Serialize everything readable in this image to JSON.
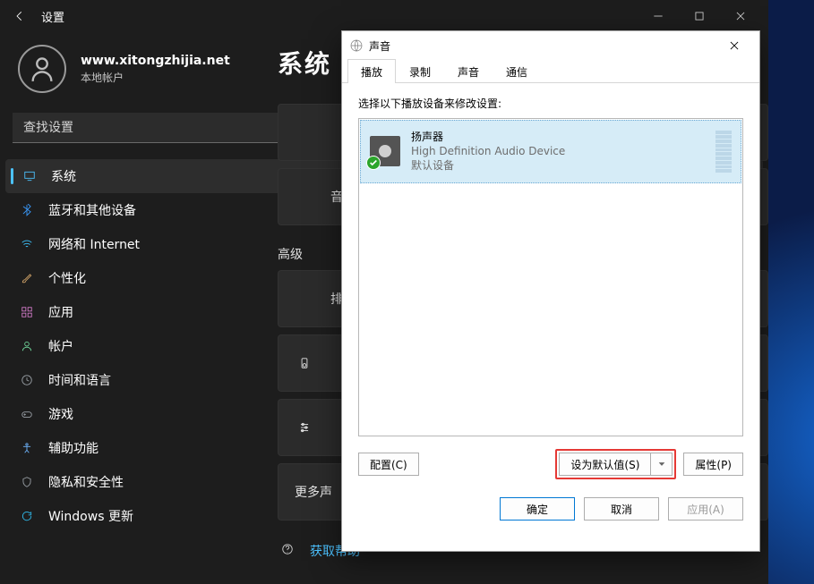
{
  "settings": {
    "title": "设置",
    "user": {
      "name": "www.xitongzhijia.net",
      "sub": "本地帐户"
    },
    "search_placeholder": "查找设置",
    "nav": {
      "system": "系统",
      "bluetooth": "蓝牙和其他设备",
      "network": "网络和 Internet",
      "personal": "个性化",
      "apps": "应用",
      "accounts": "帐户",
      "time": "时间和语言",
      "game": "游戏",
      "access": "辅助功能",
      "privacy": "隐私和安全性",
      "update": "Windows 更新"
    },
    "main": {
      "page_title": "系统",
      "card_sound": "音量",
      "section_advanced": "高级",
      "card_trouble": "排查常",
      "card_more": "更多声",
      "help_link": "获取帮助"
    }
  },
  "sound_dialog": {
    "title": "声音",
    "tabs": {
      "play": "播放",
      "record": "录制",
      "sound": "声音",
      "comm": "通信"
    },
    "instruction": "选择以下播放设备来修改设置:",
    "device": {
      "name": "扬声器",
      "sub": "High Definition Audio Device",
      "state": "默认设备"
    },
    "buttons": {
      "configure": "配置(C)",
      "set_default": "设为默认值(S)",
      "properties": "属性(P)",
      "ok": "确定",
      "cancel": "取消",
      "apply": "应用(A)"
    }
  }
}
